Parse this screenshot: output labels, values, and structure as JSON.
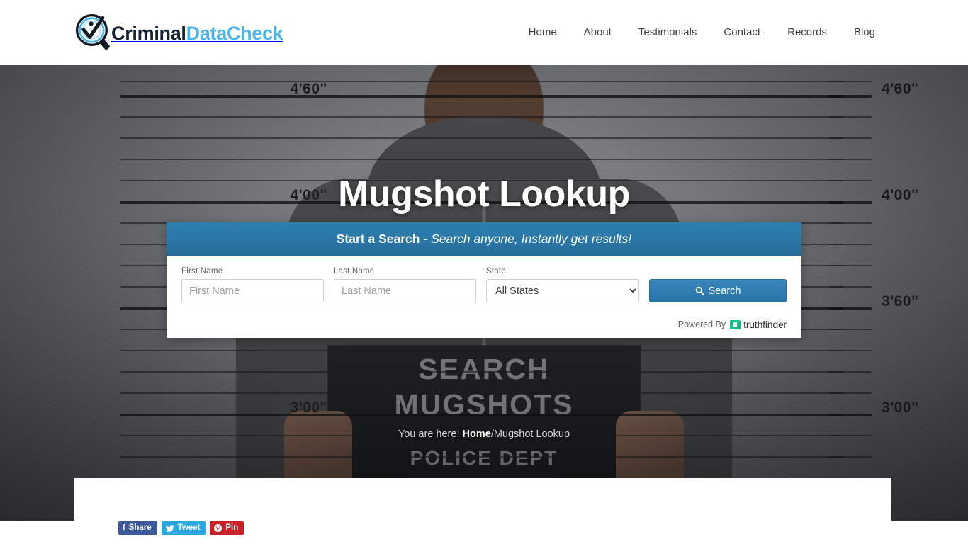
{
  "header": {
    "logo": {
      "icon": "magnifier-check-icon",
      "text_dark": "Criminal",
      "text_blue": "DataCheck",
      "brand_blue": "#4ab5e8",
      "brand_dark": "#15212e"
    },
    "nav": [
      {
        "label": "Home"
      },
      {
        "label": "About"
      },
      {
        "label": "Testimonials"
      },
      {
        "label": "Contact"
      },
      {
        "label": "Records"
      },
      {
        "label": "Blog"
      }
    ]
  },
  "hero": {
    "title": "Mugshot Lookup",
    "ruler_labels": [
      "4'60\"",
      "4'00\"",
      "3'60\"",
      "3'00\""
    ],
    "sign": {
      "line1": "SEARCH",
      "line2": "MUGSHOTS",
      "line3": "POLICE DEPT"
    },
    "breadcrumb": {
      "prefix": "You are here:",
      "home": "Home",
      "separator": "/",
      "current": "Mugshot Lookup"
    }
  },
  "search_panel": {
    "head_bold": "Start a Search",
    "head_italic": "- Search anyone, Instantly get results!",
    "accent_color": "#2a79a9",
    "first_name": {
      "label": "First Name",
      "placeholder": "First Name",
      "value": ""
    },
    "last_name": {
      "label": "Last Name",
      "placeholder": "Last Name",
      "value": ""
    },
    "state": {
      "label": "State",
      "selected": "All States",
      "options": [
        "All States"
      ]
    },
    "search_button": {
      "label": "Search",
      "icon": "search-icon"
    },
    "powered_by": {
      "prefix": "Powered By",
      "brand": "truthfinder",
      "brand_color": "#12c48d"
    }
  },
  "share": {
    "buttons": [
      {
        "label": "Share",
        "icon": "facebook-icon",
        "color": "#3b5998"
      },
      {
        "label": "Tweet",
        "icon": "twitter-icon",
        "color": "#2aa9e0"
      },
      {
        "label": "Pin",
        "icon": "pinterest-icon",
        "color": "#cb2027"
      }
    ]
  }
}
